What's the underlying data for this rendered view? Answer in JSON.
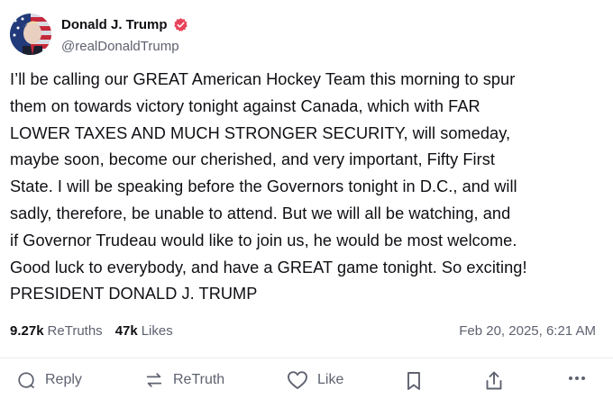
{
  "post": {
    "author_name": "Donald J. Trump",
    "handle": "@realDonaldTrump",
    "body": "I’ll be calling our GREAT American Hockey Team this morning to spur\nthem on towards victory tonight against Canada, which with FAR\nLOWER TAXES AND MUCH STRONGER SECURITY, will someday,\nmaybe soon, become our cherished, and very important, Fifty First\nState. I will be speaking before the Governors tonight in D.C., and will\nsadly, therefore, be unable to attend. But we will all be watching, and\nif Governor Trudeau would like to join us, he would be most welcome.\nGood luck to everybody, and have a GREAT game tonight. So exciting!\nPRESIDENT DONALD J. TRUMP",
    "retruths_count": "9.27k",
    "retruths_label": "ReTruths",
    "likes_count": "47k",
    "likes_label": "Likes",
    "timestamp": "Feb 20, 2025, 6:21 AM"
  },
  "actions": {
    "reply_label": "Reply",
    "retruth_label": "ReTruth",
    "like_label": "Like"
  },
  "icons": {
    "verified": "verified-badge-icon",
    "reply": "reply-bubble-icon",
    "retruth": "retruth-arrows-icon",
    "like": "heart-icon",
    "bookmark": "bookmark-icon",
    "share": "share-upload-icon",
    "more": "more-dots-icon"
  },
  "colors": {
    "verified_badge": "#e8435a",
    "text_primary": "#0f0f14",
    "text_secondary": "#5f6270"
  }
}
